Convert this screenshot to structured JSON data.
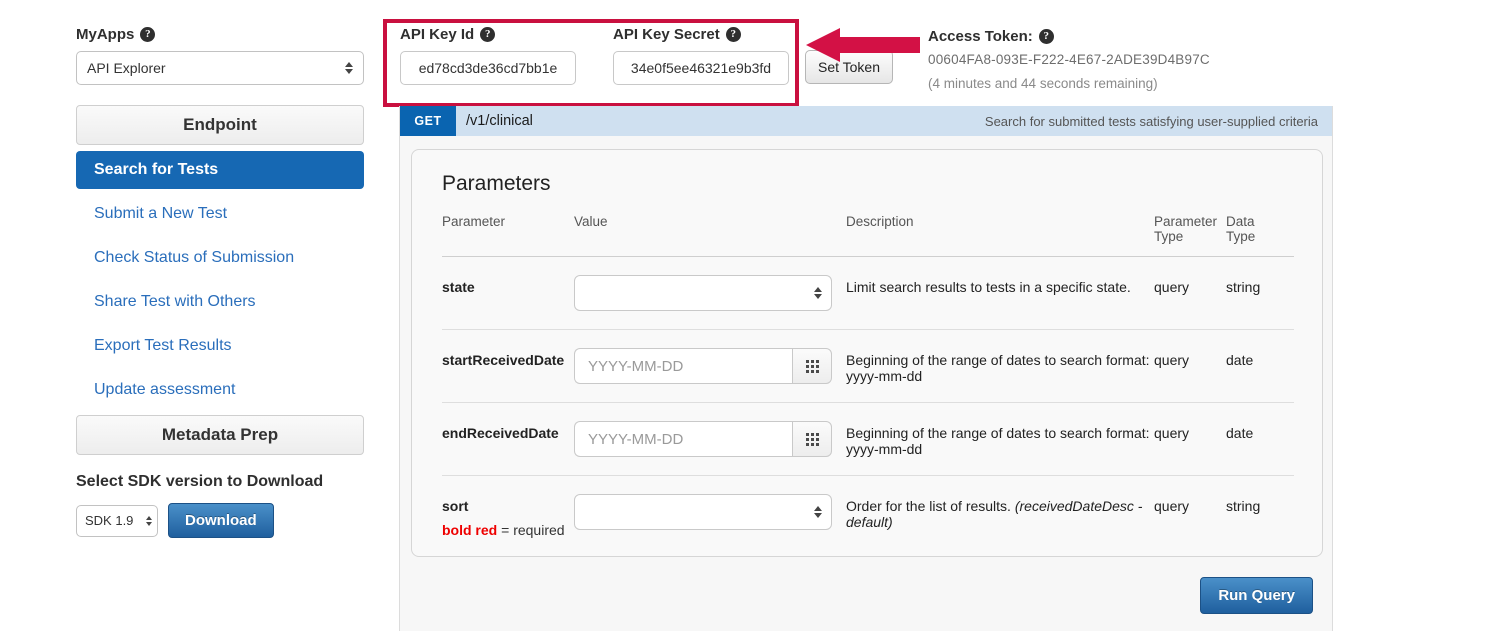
{
  "sidebar": {
    "myapps_label": "MyApps",
    "myapps_help_glyph": "?",
    "myapps_value": "API Explorer",
    "endpoint_header": "Endpoint",
    "nav_items": [
      {
        "label": "Search for Tests",
        "active": true
      },
      {
        "label": "Submit a New Test",
        "active": false
      },
      {
        "label": "Check Status of Submission",
        "active": false
      },
      {
        "label": "Share Test with Others",
        "active": false
      },
      {
        "label": "Export Test Results",
        "active": false
      },
      {
        "label": "Update assessment",
        "active": false
      }
    ],
    "metadata_header": "Metadata Prep",
    "sdk_title": "Select SDK version to Download",
    "sdk_value": "SDK 1.9",
    "download_label": "Download"
  },
  "credentials": {
    "api_key_id_label": "API Key Id",
    "api_key_id_value": "ed78cd3de36cd7bb1e",
    "api_key_secret_label": "API Key Secret",
    "api_key_secret_value": "34e0f5ee46321e9b3fd",
    "set_token_label": "Set Token",
    "help_glyph": "?"
  },
  "access_token": {
    "title": "Access Token:",
    "value": "00604FA8-093E-F222-4E67-2ADE39D4B97C",
    "remaining": "(4 minutes and 44 seconds remaining)",
    "help_glyph": "?"
  },
  "endpoint_bar": {
    "method": "GET",
    "path": "/v1/clinical",
    "description": "Search for submitted tests satisfying user-supplied criteria"
  },
  "parameters_panel": {
    "title": "Parameters",
    "columns": {
      "parameter": "Parameter",
      "value": "Value",
      "description": "Description",
      "parameter_type": "Parameter\nType",
      "parameter_type_line1": "Parameter",
      "parameter_type_line2": "Type",
      "data_type_line1": "Data",
      "data_type_line2": "Type"
    },
    "rows": [
      {
        "name": "state",
        "control": "select",
        "value": "",
        "placeholder": "",
        "description": "Limit search results to tests in a specific state.",
        "description_em": "",
        "parameter_type": "query",
        "data_type": "string"
      },
      {
        "name": "startReceivedDate",
        "control": "date",
        "value": "",
        "placeholder": "YYYY-MM-DD",
        "description": "Beginning of the range of dates to search format: yyyy-mm-dd",
        "description_em": "",
        "parameter_type": "query",
        "data_type": "date"
      },
      {
        "name": "endReceivedDate",
        "control": "date",
        "value": "",
        "placeholder": "YYYY-MM-DD",
        "description": "Beginning of the range of dates to search format: yyyy-mm-dd",
        "description_em": "",
        "parameter_type": "query",
        "data_type": "date"
      },
      {
        "name": "sort",
        "control": "select",
        "value": "",
        "placeholder": "",
        "description": "Order for the list of results. ",
        "description_em": "(receivedDateDesc - default)",
        "parameter_type": "query",
        "data_type": "string"
      }
    ],
    "required_note_bold": "bold red",
    "required_note_rest": " = required"
  },
  "footer": {
    "run_query_label": "Run Query"
  },
  "annotations": {
    "highlight_color": "#c9103f",
    "arrow_color": "#d31145",
    "arrow_name": "left-pointing-arrow"
  },
  "colors": {
    "accent_blue": "#1668b3",
    "link_blue": "#2a6ebb",
    "method_blue": "#0a64b0",
    "endpoint_bar_bg": "#cfe0f0",
    "required_red": "#ee0000"
  }
}
